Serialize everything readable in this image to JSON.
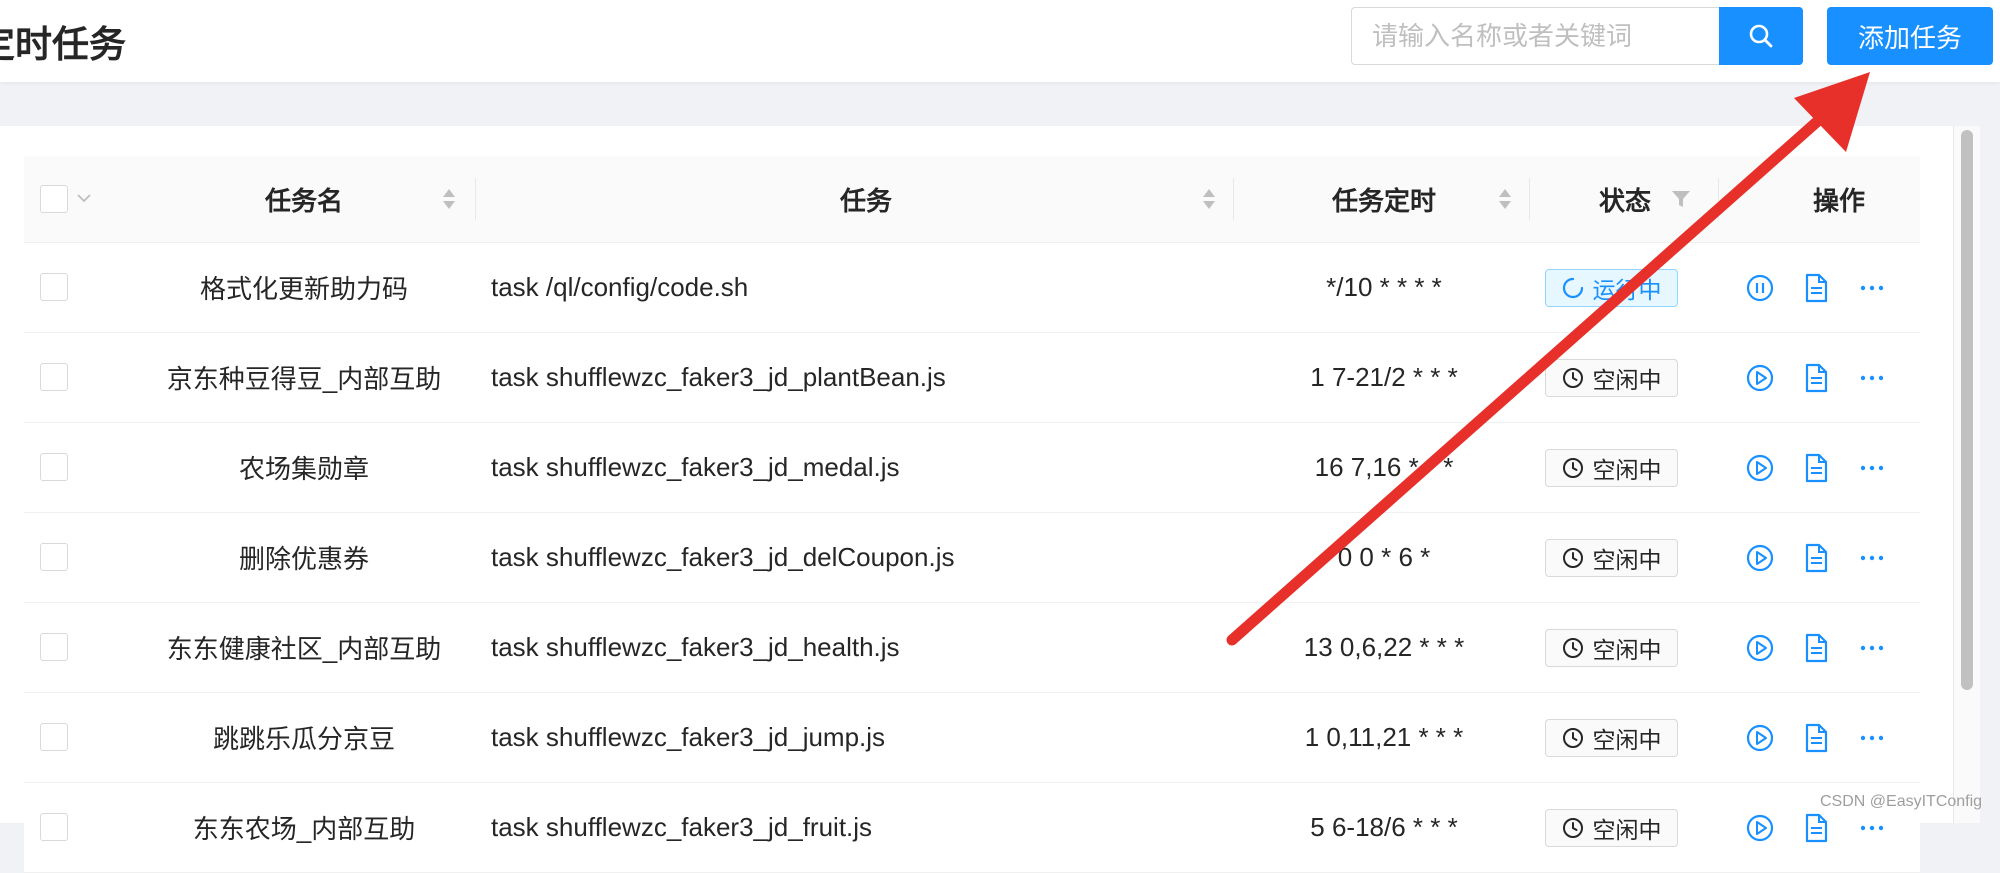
{
  "header": {
    "title": "定时任务",
    "search_placeholder": "请输入名称或者关键词",
    "add_button_label": "添加任务"
  },
  "table": {
    "columns": {
      "name": "任务名",
      "command": "任务",
      "schedule": "任务定时",
      "status": "状态",
      "actions": "操作"
    },
    "rows": [
      {
        "name": "格式化更新助力码",
        "command": "task /ql/config/code.sh",
        "schedule": "*/10 * * * *",
        "status": "运行中",
        "running": true
      },
      {
        "name": "京东种豆得豆_内部互助",
        "command": "task shufflewzc_faker3_jd_plantBean.js",
        "schedule": "1 7-21/2 * * *",
        "status": "空闲中",
        "running": false
      },
      {
        "name": "农场集勋章",
        "command": "task shufflewzc_faker3_jd_medal.js",
        "schedule": "16 7,16 * * *",
        "status": "空闲中",
        "running": false
      },
      {
        "name": "删除优惠券",
        "command": "task shufflewzc_faker3_jd_delCoupon.js",
        "schedule": "0 0 * 6 *",
        "status": "空闲中",
        "running": false
      },
      {
        "name": "东东健康社区_内部互助",
        "command": "task shufflewzc_faker3_jd_health.js",
        "schedule": "13 0,6,22 * * *",
        "status": "空闲中",
        "running": false
      },
      {
        "name": "跳跳乐瓜分京豆",
        "command": "task shufflewzc_faker3_jd_jump.js",
        "schedule": "1 0,11,21 * * *",
        "status": "空闲中",
        "running": false
      },
      {
        "name": "东东农场_内部互助",
        "command": "task shufflewzc_faker3_jd_fruit.js",
        "schedule": "5 6-18/6 * * *",
        "status": "空闲中",
        "running": false
      }
    ]
  },
  "icons": {
    "search": "search-icon",
    "sort": "sort-icon",
    "filter": "filter-icon",
    "run": "play-circle-icon",
    "pause": "pause-circle-icon",
    "log": "file-text-icon",
    "more": "more-icon",
    "idle": "clock-icon",
    "running": "loading-icon"
  },
  "colors": {
    "primary": "#1890ff",
    "annotation_arrow": "#e8302a"
  },
  "watermark": "CSDN @EasyITConfig"
}
